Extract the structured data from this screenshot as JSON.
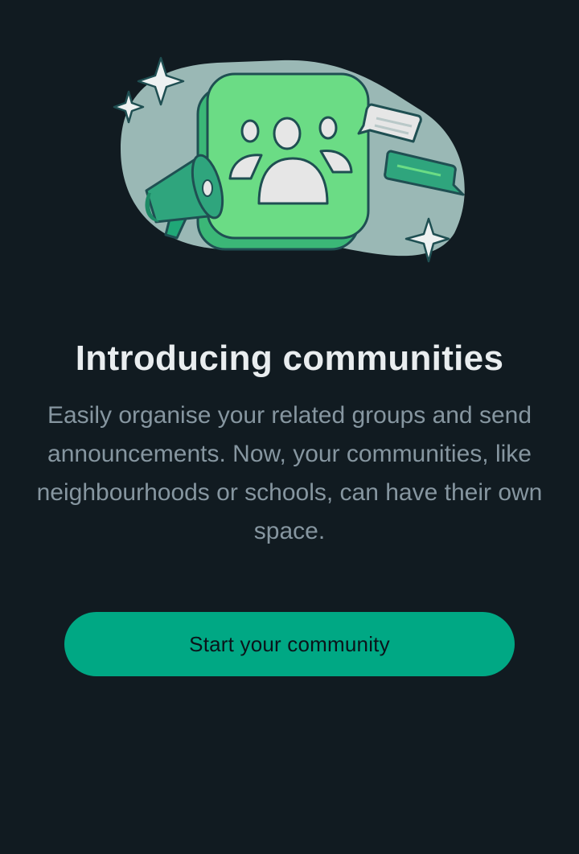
{
  "onboarding": {
    "title": "Introducing communities",
    "description": "Easily organise your related groups and send announcements. Now, your communities, like neighbourhoods or schools, can have their own space.",
    "cta_label": "Start your community"
  },
  "illustration": {
    "icons": [
      "sparkle-icon",
      "megaphone-icon",
      "community-group-icon",
      "chat-bubble-icon"
    ]
  },
  "colors": {
    "background": "#111b21",
    "accent": "#00a884",
    "title": "#e9edef",
    "body_text": "#8696a0",
    "illustration_blob": "#9ab8b5",
    "tile_green": "#6bdc85",
    "outline": "#1f4f52"
  }
}
